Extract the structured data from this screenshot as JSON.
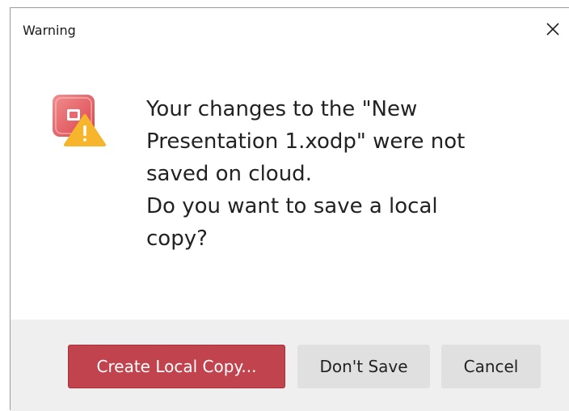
{
  "window": {
    "title": "Warning"
  },
  "dialog": {
    "icon": "presentation-warning-icon",
    "message": "Your changes to the \"New\nPresentation 1.xodp\" were not\nsaved on cloud.\nDo you want to save a local\ncopy?"
  },
  "buttons": {
    "create_local_copy": "Create Local Copy...",
    "dont_save": "Don't Save",
    "cancel": "Cancel"
  },
  "colors": {
    "primary_button": "#c0434d",
    "secondary_button": "#e0e0e0",
    "footer": "#efefef",
    "warning": "#f7b52b"
  }
}
